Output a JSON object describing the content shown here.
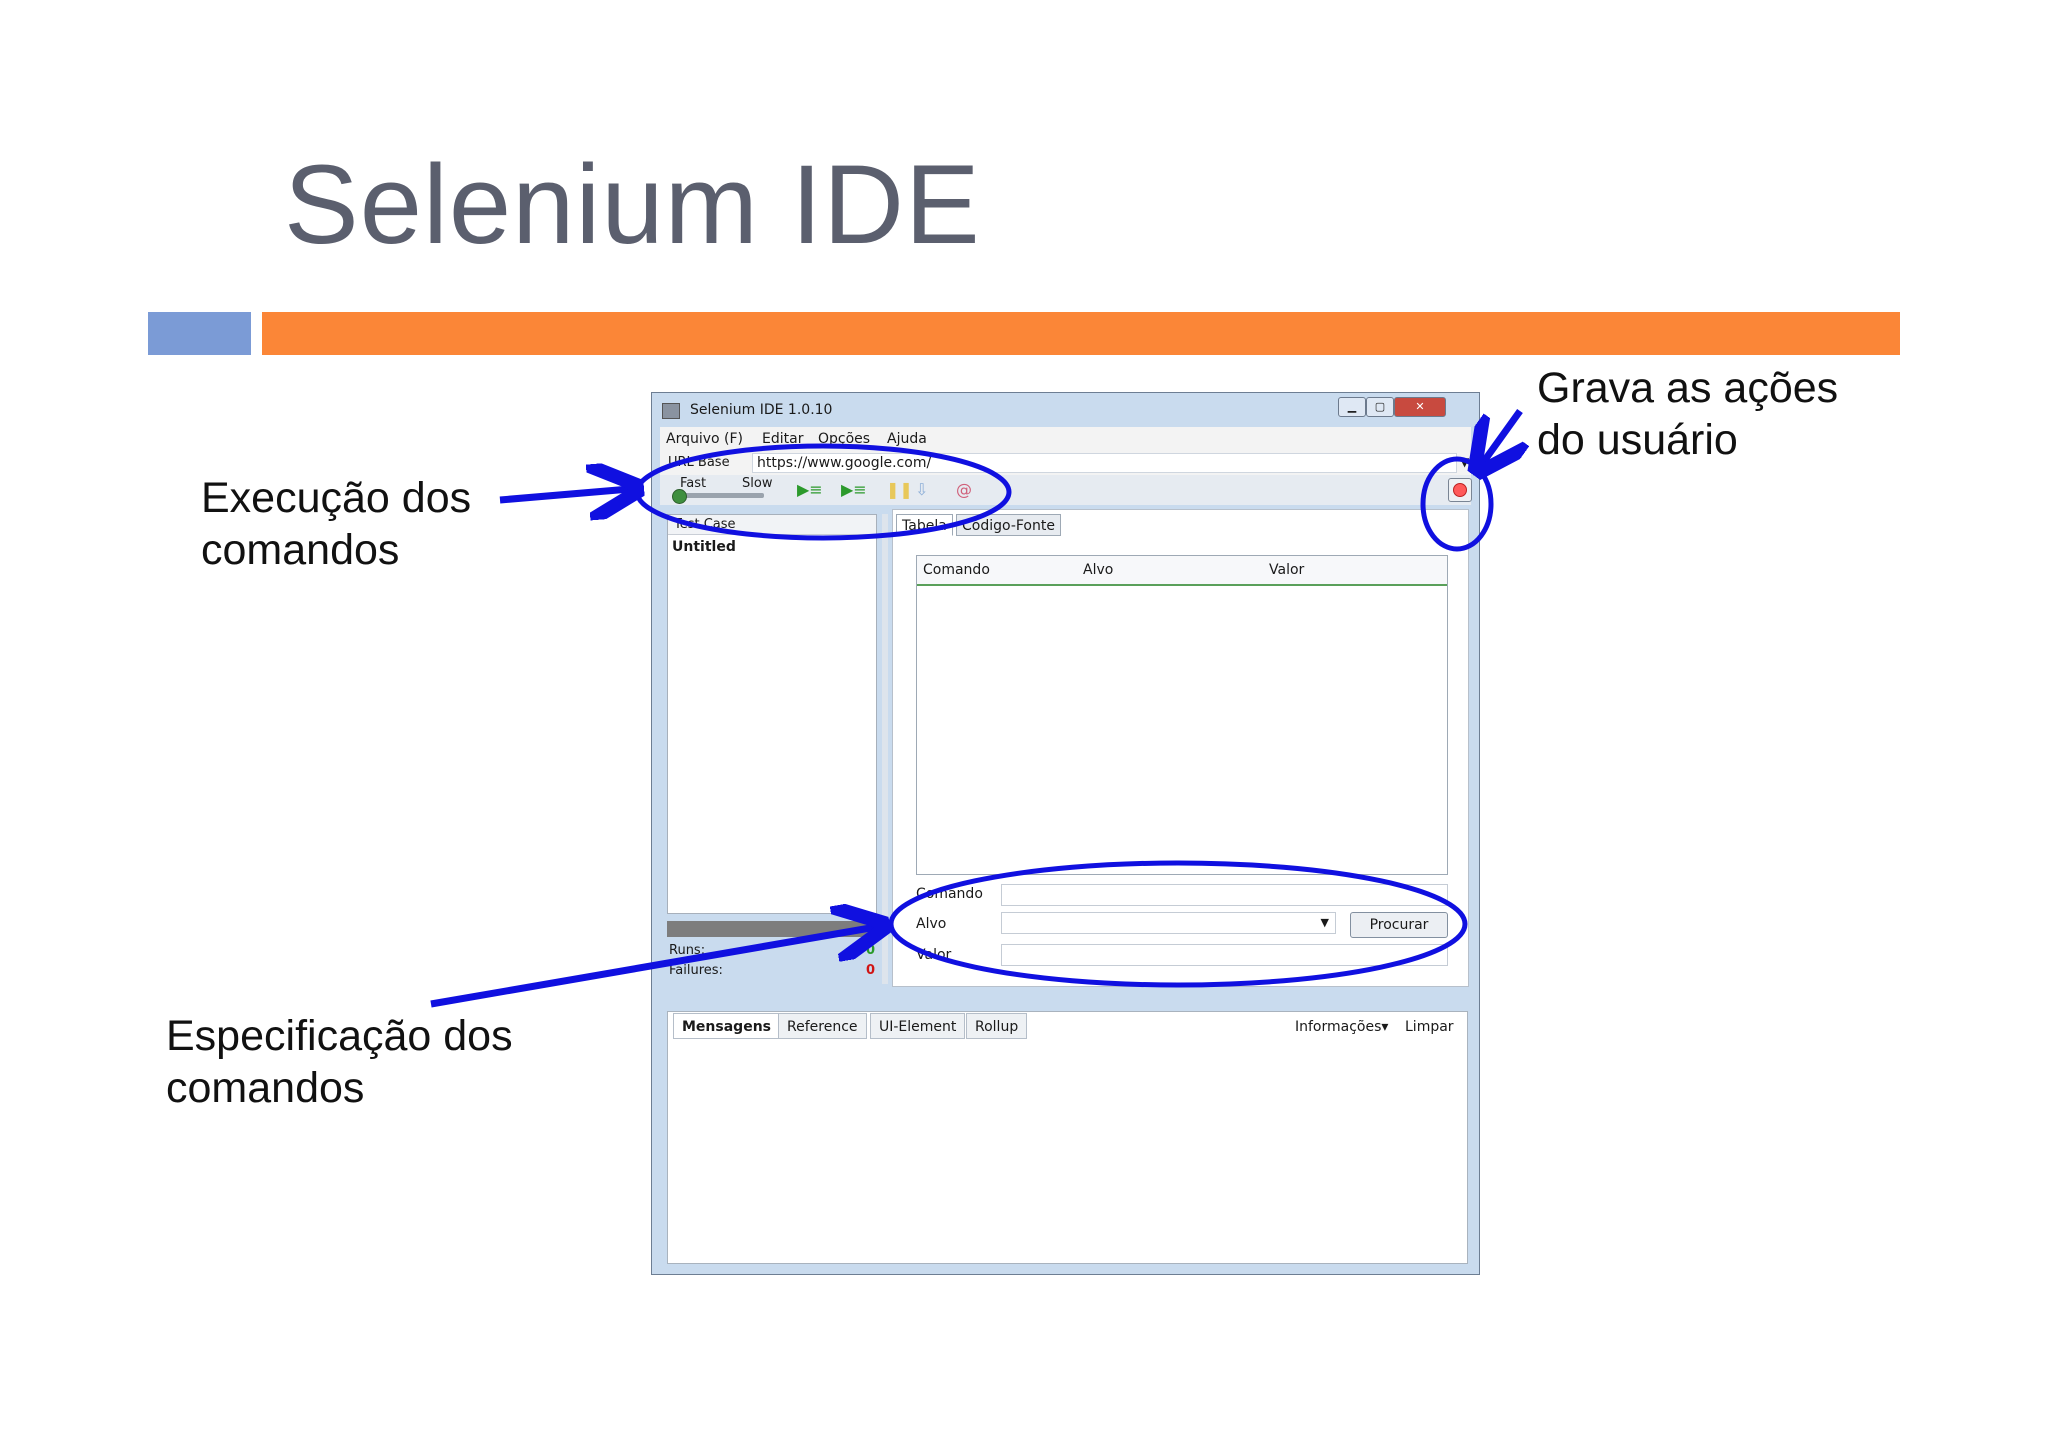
{
  "slide": {
    "title": "Selenium IDE",
    "annotations": {
      "execucao": [
        "Execução dos",
        "comandos"
      ],
      "grava": [
        "Grava as ações",
        "do usuário"
      ],
      "especificacao": [
        "Especificação dos",
        "comandos"
      ]
    }
  },
  "window": {
    "title": "Selenium IDE 1.0.10",
    "menu": [
      "Arquivo (F)",
      "Editar",
      "Opções",
      "Ajuda"
    ],
    "url_label": "URL Base",
    "url_value": "https://www.google.com/",
    "speed": {
      "fast": "Fast",
      "slow": "Slow"
    },
    "left_pane": {
      "header": "Test Case",
      "item": "Untitled"
    },
    "stats": {
      "runs_label": "Runs:",
      "runs_value": "0",
      "failures_label": "Failures:",
      "failures_value": "0"
    },
    "tabs": [
      "Tabela",
      "Código-Fonte"
    ],
    "table_headers": [
      "Comando",
      "Alvo",
      "Valor"
    ],
    "form": {
      "comando": "Comando",
      "alvo": "Alvo",
      "valor": "Valor",
      "procurar": "Procurar"
    },
    "bottom_tabs": [
      "Mensagens",
      "Reference",
      "UI-Element",
      "Rollup"
    ],
    "bottom_right": {
      "info": "Informações▾",
      "clear": "Limpar"
    }
  },
  "colors": {
    "title": "#5b5f6e",
    "bar_blue": "#7b9bd6",
    "bar_orange": "#fb8637",
    "annotation_blue": "#1010e0",
    "record_red": "#ff5a5a"
  }
}
